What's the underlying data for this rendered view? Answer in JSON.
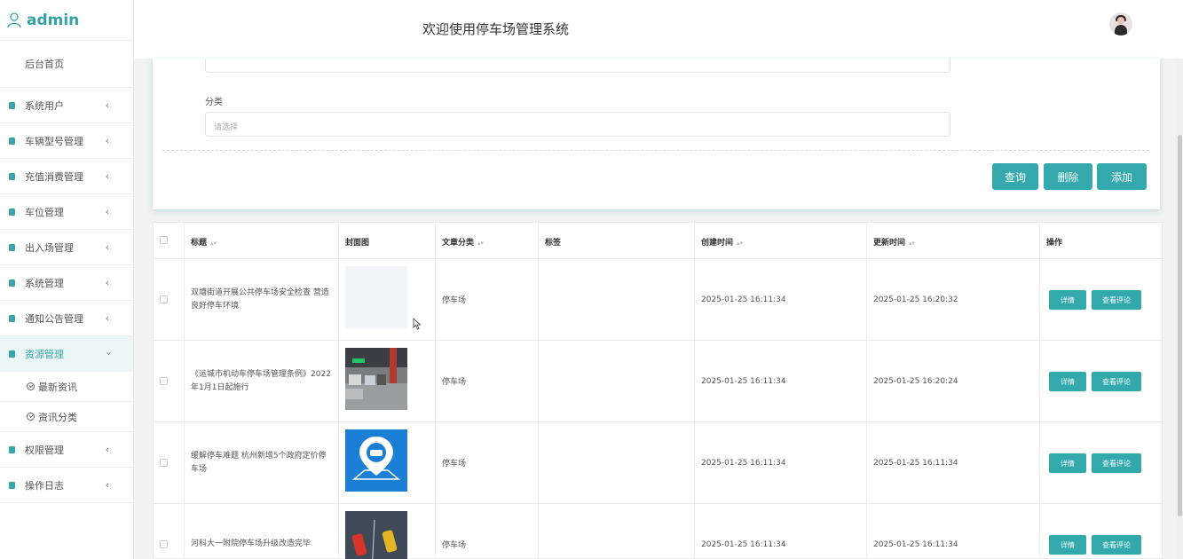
{
  "sidebar": {
    "brand": "admin",
    "home": "后台首页",
    "items": [
      {
        "label": "系统用户"
      },
      {
        "label": "车辆型号管理"
      },
      {
        "label": "充值消费管理"
      },
      {
        "label": "车位管理"
      },
      {
        "label": "出入场管理"
      },
      {
        "label": "系统管理"
      },
      {
        "label": "通知公告管理"
      },
      {
        "label": "资源管理"
      },
      {
        "label": "权限管理"
      },
      {
        "label": "操作日志"
      }
    ],
    "submenu": [
      {
        "label": "最新资讯"
      },
      {
        "label": "资讯分类"
      }
    ],
    "active_item": "资源管理"
  },
  "header": {
    "title": "欢迎使用停车场管理系统"
  },
  "search": {
    "category_label": "分类",
    "category_placeholder": "请选择",
    "query_label": "查询",
    "delete_label": "删除",
    "add_label": "添加"
  },
  "table": {
    "headers": {
      "title": "标题",
      "cover": "封面图",
      "category": "文章分类",
      "tags": "标签",
      "created": "创建时间",
      "updated": "更新时间",
      "actions": "操作"
    },
    "rows": [
      {
        "title": "双塘街道开展公共停车场安全检查 营造良好停车环境",
        "category": "停车场",
        "tags": "",
        "created": "2025-01-25 16:11:34",
        "updated": "2025-01-25 16:20:32"
      },
      {
        "title": "《运城市机动车停车场管理条例》2022年1月1日起施行",
        "category": "停车场",
        "tags": "",
        "created": "2025-01-25 16:11:34",
        "updated": "2025-01-25 16:20:24"
      },
      {
        "title": "缓解停车难题 杭州新增5个政府定价停车场",
        "category": "停车场",
        "tags": "",
        "created": "2025-01-25 16:11:34",
        "updated": "2025-01-25 16:11:34"
      },
      {
        "title": "河科大一附院停车场升级改造完毕",
        "category": "停车场",
        "tags": "",
        "created": "2025-01-25 16:11:34",
        "updated": "2025-01-25 16:11:34"
      }
    ],
    "detail_label": "详情",
    "comments_label": "查看评论"
  },
  "colors": {
    "accent": "#34a9ad",
    "brand": "#34a3a8",
    "active_bg": "#ebf6f6"
  }
}
